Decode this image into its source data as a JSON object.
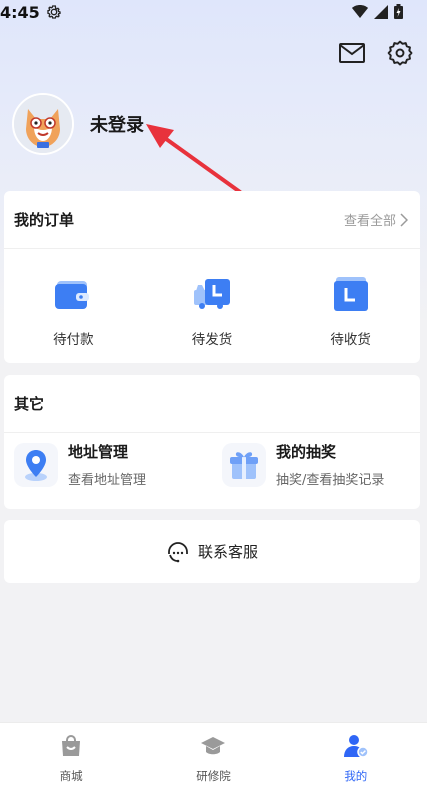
{
  "status_bar": {
    "time": "4:45"
  },
  "header": {
    "mail_icon": "mail-icon",
    "settings_icon": "gear-icon"
  },
  "profile": {
    "login_text": "未登录"
  },
  "orders": {
    "title": "我的订单",
    "view_all": "查看全部",
    "items": [
      {
        "label": "待付款",
        "icon": "wallet-icon"
      },
      {
        "label": "待发货",
        "icon": "truck-icon"
      },
      {
        "label": "待收货",
        "icon": "box-icon"
      }
    ]
  },
  "other": {
    "title": "其它",
    "items": [
      {
        "title": "地址管理",
        "subtitle": "查看地址管理",
        "icon": "location-pin-icon"
      },
      {
        "title": "我的抽奖",
        "subtitle": "抽奖/查看抽奖记录",
        "icon": "gift-icon"
      }
    ]
  },
  "service": {
    "label": "联系客服",
    "icon": "headset-icon"
  },
  "tabbar": {
    "tabs": [
      {
        "label": "商城",
        "icon": "shopping-bag-icon",
        "active": false
      },
      {
        "label": "研修院",
        "icon": "graduation-cap-icon",
        "active": false
      },
      {
        "label": "我的",
        "icon": "user-icon",
        "active": true
      }
    ]
  },
  "colors": {
    "accent": "#2f66f6",
    "arrow": "#e8323c",
    "icon_blue": "#4a86f7"
  }
}
